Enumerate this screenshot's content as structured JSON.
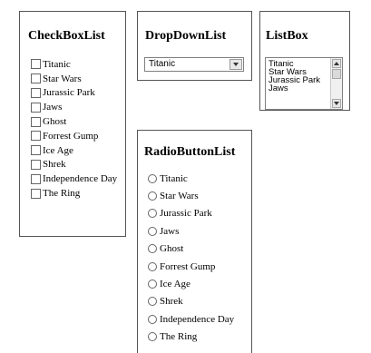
{
  "checkboxlist": {
    "title": "CheckBoxList",
    "items": [
      {
        "label": "Titanic",
        "checked": false
      },
      {
        "label": "Star Wars",
        "checked": false
      },
      {
        "label": "Jurassic Park",
        "checked": false
      },
      {
        "label": "Jaws",
        "checked": false
      },
      {
        "label": "Ghost",
        "checked": false
      },
      {
        "label": "Forrest Gump",
        "checked": false
      },
      {
        "label": "Ice Age",
        "checked": false
      },
      {
        "label": "Shrek",
        "checked": false
      },
      {
        "label": "Independence Day",
        "checked": false
      },
      {
        "label": "The Ring",
        "checked": false
      }
    ]
  },
  "dropdownlist": {
    "title": "DropDownList",
    "selected": "Titanic",
    "button_icon": "chevron-down-icon"
  },
  "listbox": {
    "title": "ListBox",
    "items": [
      "Titanic",
      "Star Wars",
      "Jurassic Park",
      "Jaws"
    ],
    "scroll_icons": [
      "scroll-up-icon",
      "scroll-down-icon"
    ]
  },
  "radiobuttonlist": {
    "title": "RadioButtonList",
    "items": [
      {
        "label": "Titanic",
        "selected": false
      },
      {
        "label": "Star Wars",
        "selected": false
      },
      {
        "label": "Jurassic Park",
        "selected": false
      },
      {
        "label": "Jaws",
        "selected": false
      },
      {
        "label": "Ghost",
        "selected": false
      },
      {
        "label": "Forrest Gump",
        "selected": false
      },
      {
        "label": "Ice Age",
        "selected": false
      },
      {
        "label": "Shrek",
        "selected": false
      },
      {
        "label": "Independence Day",
        "selected": false
      },
      {
        "label": "The Ring",
        "selected": false
      }
    ]
  }
}
